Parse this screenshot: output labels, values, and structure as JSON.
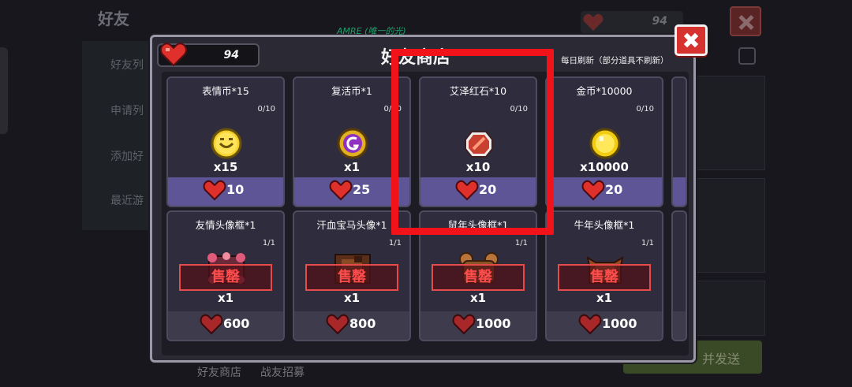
{
  "background": {
    "title": "好友",
    "side_items": [
      "好友列",
      "申请列",
      "添加好",
      "最近游"
    ],
    "heart_count": "94",
    "hint_text": "AMRE (唯一的光)",
    "bottom_button": "并发送",
    "tabs": [
      "好友商店",
      "战友招募"
    ]
  },
  "shop": {
    "title": "好友商店",
    "refresh_note": "每日刷新（部分道具不刷新）",
    "heart_total": "94",
    "close_icon": "close-icon",
    "row1": [
      {
        "name": "表情币*15",
        "stock": "0/10",
        "qty": "x15",
        "price": "10",
        "icon": "smiley-coin-icon"
      },
      {
        "name": "复活币*1",
        "stock": "0/10",
        "qty": "x1",
        "price": "25",
        "icon": "revive-coin-icon"
      },
      {
        "name": "艾泽红石*10",
        "stock": "0/10",
        "qty": "x10",
        "price": "20",
        "icon": "red-stone-icon"
      },
      {
        "name": "金币*10000",
        "stock": "0/10",
        "qty": "x10000",
        "price": "20",
        "icon": "gold-coin-icon"
      }
    ],
    "row2": [
      {
        "name": "友情头像框*1",
        "stock": "1/1",
        "qty": "x1",
        "price": "600",
        "status": "售罄",
        "icon": "flower-frame-icon"
      },
      {
        "name": "汗血宝马头像*1",
        "stock": "1/1",
        "qty": "x1",
        "price": "800",
        "status": "售罄",
        "icon": "horse-avatar-icon"
      },
      {
        "name": "鼠年头像框*1",
        "stock": "1/1",
        "qty": "x1",
        "price": "1000",
        "status": "售罄",
        "icon": "rat-frame-icon"
      },
      {
        "name": "牛年头像框*1",
        "stock": "1/1",
        "qty": "x1",
        "price": "1000",
        "status": "售罄",
        "icon": "ox-frame-icon"
      }
    ]
  },
  "colors": {
    "highlight": "#f2121a",
    "price_bar": "#5d5596",
    "soldout": "#ff4c4c",
    "close_button": "#d6322f"
  }
}
